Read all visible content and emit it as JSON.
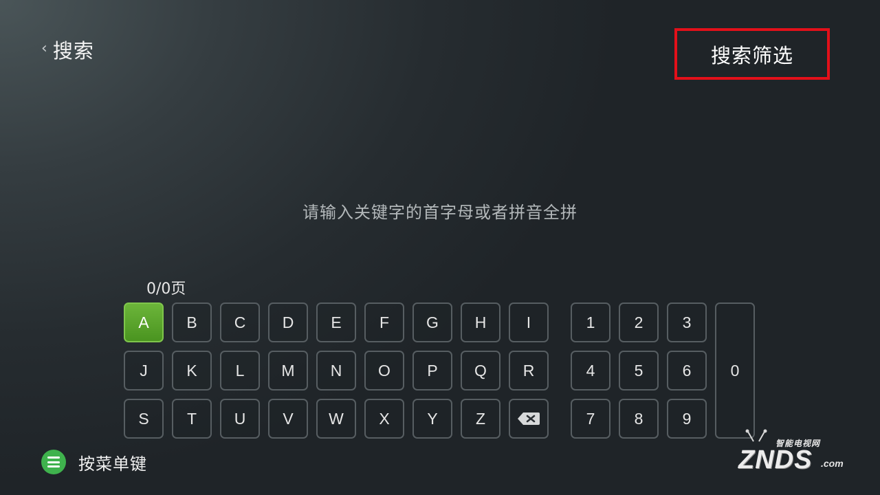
{
  "header": {
    "back_chevron": "‹",
    "title": "搜索",
    "filter_button": "搜索筛选"
  },
  "search": {
    "hint": "请输入关键字的首字母或者拼音全拼",
    "page_counter": "0/0页"
  },
  "keyboard": {
    "letters_row1": [
      "A",
      "B",
      "C",
      "D",
      "E",
      "F",
      "G",
      "H",
      "I"
    ],
    "letters_row2": [
      "J",
      "K",
      "L",
      "M",
      "N",
      "O",
      "P",
      "Q",
      "R"
    ],
    "letters_row3": [
      "S",
      "T",
      "U",
      "V",
      "W",
      "X",
      "Y",
      "Z"
    ],
    "digits_row1": [
      "1",
      "2",
      "3"
    ],
    "digits_row2": [
      "4",
      "5",
      "6"
    ],
    "digits_row3": [
      "7",
      "8",
      "9"
    ],
    "zero": "0",
    "selected_key": "A",
    "backspace_icon": "backspace-icon"
  },
  "footer": {
    "menu_icon": "menu-icon",
    "menu_label": "按菜单键"
  },
  "watermark": {
    "top": "智能电视网",
    "main": "ZNDS",
    "suffix": ".com"
  },
  "colors": {
    "selected_key": "#5aa52c",
    "highlight_border": "#e3101a",
    "menu_icon": "#3fb24d"
  }
}
